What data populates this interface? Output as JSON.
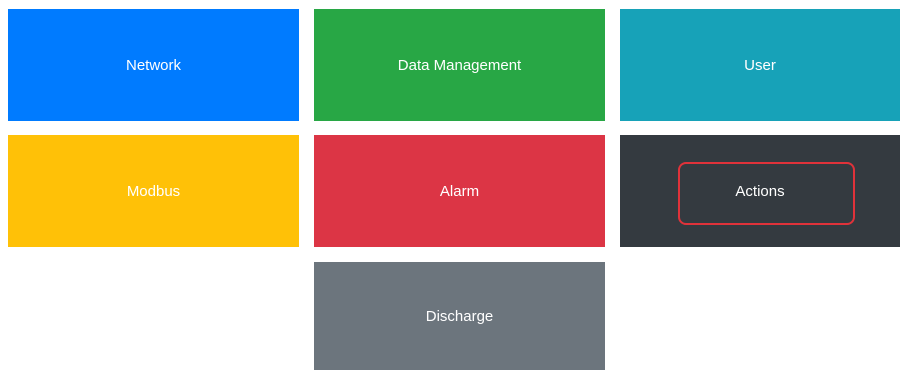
{
  "tiles": {
    "network": {
      "label": "Network",
      "color": "#007bff"
    },
    "data_management": {
      "label": "Data Management",
      "color": "#28a745"
    },
    "user": {
      "label": "User",
      "color": "#17a2b8"
    },
    "modbus": {
      "label": "Modbus",
      "color": "#ffc107"
    },
    "alarm": {
      "label": "Alarm",
      "color": "#dc3545"
    },
    "actions": {
      "label": "Actions",
      "color": "#343a40",
      "highlighted": true
    },
    "discharge": {
      "label": "Discharge",
      "color": "#6c757d"
    }
  },
  "highlight": {
    "target": "actions",
    "color": "#e0323a"
  }
}
